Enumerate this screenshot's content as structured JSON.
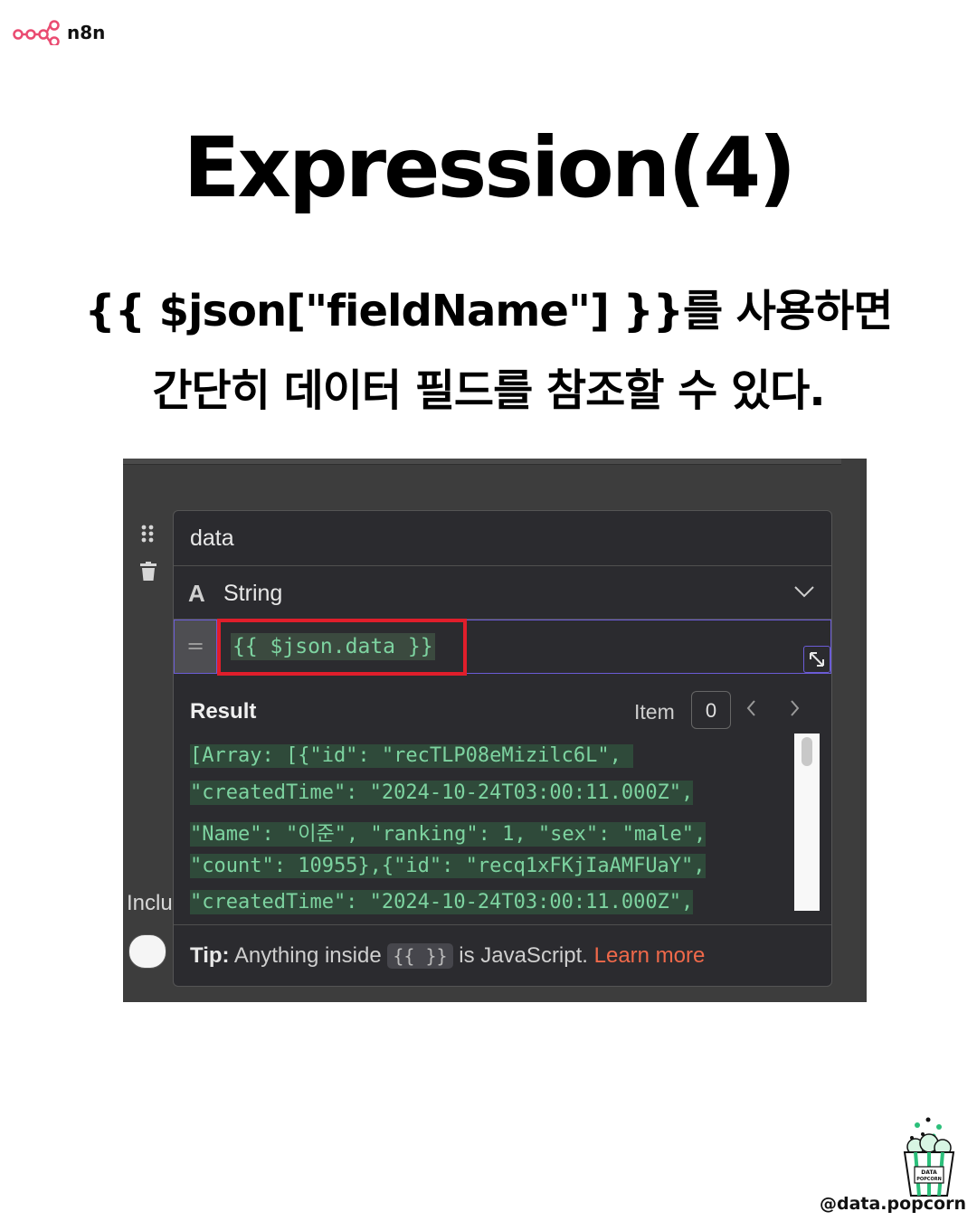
{
  "brand": {
    "name": "n8n",
    "icon": "n8n-logo-icon",
    "accent": "#ea4b71"
  },
  "title": "Expression(4)",
  "subtitle": {
    "line1": "{{ $json[\"fieldName\"] }}를 사용하면",
    "line2": "간단히 데이터 필드를 참조할 수 있다."
  },
  "screenshot": {
    "field_name": "data",
    "type_icon_letter": "A",
    "type_label": "String",
    "expression_prefix": "=",
    "expression": "{{ $json.data }}",
    "highlight_color": "#e01e2b",
    "result_label": "Result",
    "item_label": "Item",
    "item_value": "0",
    "result_lines": [
      "[Array: [{\"id\": \"recTLP08eMizilc6L\", ",
      "\"createdTime\": \"2024-10-24T03:00:11.000Z\",",
      "\"Name\": \"이준\", \"ranking\": 1, \"sex\": \"male\",",
      "\"count\": 10955},{\"id\": \"recq1xFKjIaAMFUaY\",",
      "\"createdTime\": \"2024-10-24T03:00:11.000Z\","
    ],
    "tip_prefix": "Tip:",
    "tip_text_before": "Anything inside",
    "tip_code": "{{ }}",
    "tip_text_after": "is JavaScript.",
    "tip_link": "Learn more",
    "side_label_partial": "Inclu"
  },
  "footer": {
    "handle": "@data.popcorn",
    "logo_text_1": "DATA",
    "logo_text_2": "POPCORN"
  }
}
